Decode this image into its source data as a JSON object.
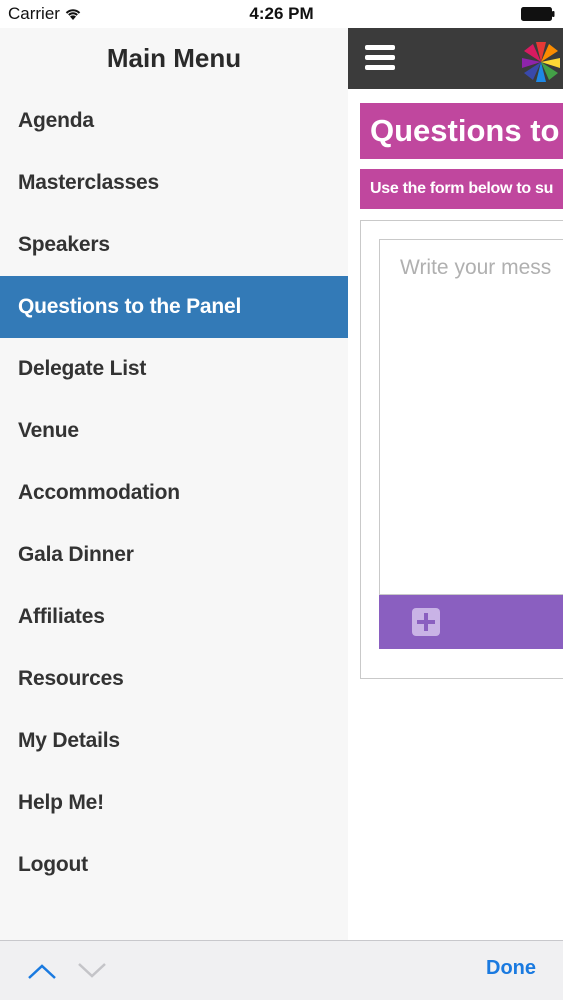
{
  "status_bar": {
    "carrier": "Carrier",
    "time": "4:26 PM"
  },
  "side_menu": {
    "title": "Main Menu",
    "items": [
      {
        "label": "Agenda",
        "active": false
      },
      {
        "label": "Masterclasses",
        "active": false
      },
      {
        "label": "Speakers",
        "active": false
      },
      {
        "label": "Questions to the Panel",
        "active": true
      },
      {
        "label": "Delegate List",
        "active": false
      },
      {
        "label": "Venue",
        "active": false
      },
      {
        "label": "Accommodation",
        "active": false
      },
      {
        "label": "Gala Dinner",
        "active": false
      },
      {
        "label": "Affiliates",
        "active": false
      },
      {
        "label": "Resources",
        "active": false
      },
      {
        "label": "My Details",
        "active": false
      },
      {
        "label": "Help Me!",
        "active": false
      },
      {
        "label": "Logout",
        "active": false
      }
    ]
  },
  "main": {
    "page_title": "Questions to",
    "subtitle": "Use the form below to su",
    "message_placeholder": "Write your mess",
    "add_icon": "plus-square-icon"
  },
  "accessory": {
    "done_label": "Done",
    "prev_icon": "chevron-up-icon",
    "next_icon": "chevron-down-icon"
  },
  "colors": {
    "header": "#3b3b3b",
    "title_bg": "#c0479e",
    "add_bar": "#8a5fc0",
    "active_item": "#337ab7",
    "done_text": "#1a7ae0"
  }
}
